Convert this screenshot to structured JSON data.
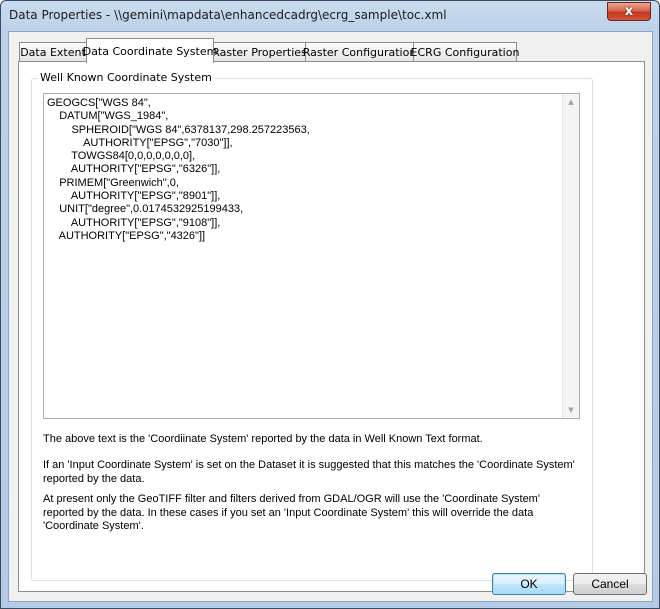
{
  "window": {
    "title": "Data Properties - \\\\gemini\\mapdata\\enhancedcadrg\\ecrg_sample\\toc.xml",
    "close_symbol": "x"
  },
  "tabs": [
    {
      "label": "Data Extent",
      "active": false
    },
    {
      "label": "Data Coordinate System",
      "active": true
    },
    {
      "label": "Raster Properties",
      "active": false
    },
    {
      "label": "Raster Configuration",
      "active": false
    },
    {
      "label": "ECRG Configuration",
      "active": false
    }
  ],
  "group": {
    "label": "Well Known Coordinate System"
  },
  "wkt": {
    "text": "GEOGCS[\"WGS 84\",\n    DATUM[\"WGS_1984\",\n        SPHEROID[\"WGS 84\",6378137,298.257223563,\n            AUTHORITY[\"EPSG\",\"7030\"]],\n        TOWGS84[0,0,0,0,0,0,0],\n        AUTHORITY[\"EPSG\",\"6326\"]],\n    PRIMEM[\"Greenwich\",0,\n        AUTHORITY[\"EPSG\",\"8901\"]],\n    UNIT[\"degree\",0.0174532925199433,\n        AUTHORITY[\"EPSG\",\"9108\"]],\n    AUTHORITY[\"EPSG\",\"4326\"]]"
  },
  "descriptions": {
    "p1": "The above text is the 'Coordiinate System' reported by the data in Well Known Text format.",
    "p2": "If an 'Input Coordinate System' is set on the Dataset it is suggested that this matches the 'Coordinate System' reported by the data.",
    "p3": "At present only the GeoTIFF filter and filters derived from GDAL/OGR will use the 'Coordinate System' reported by the data. In these cases if you set an 'Input Coordinate System' this will override the data 'Coordinate System'."
  },
  "buttons": {
    "ok": "OK",
    "cancel": "Cancel"
  },
  "colors": {
    "title_bar": "#bcd2ea",
    "close_button": "#c0391f",
    "default_button_border": "#3c7fb1"
  }
}
